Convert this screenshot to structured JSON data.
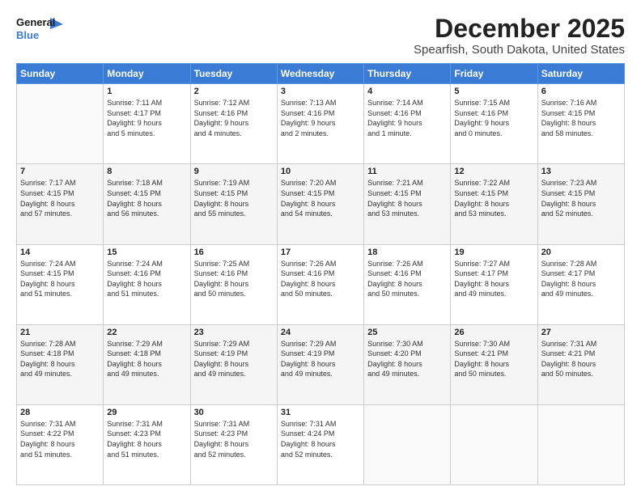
{
  "header": {
    "logo_line1": "General",
    "logo_line2": "Blue",
    "month": "December 2025",
    "location": "Spearfish, South Dakota, United States"
  },
  "weekdays": [
    "Sunday",
    "Monday",
    "Tuesday",
    "Wednesday",
    "Thursday",
    "Friday",
    "Saturday"
  ],
  "weeks": [
    [
      {
        "day": "",
        "info": ""
      },
      {
        "day": "1",
        "info": "Sunrise: 7:11 AM\nSunset: 4:17 PM\nDaylight: 9 hours\nand 5 minutes."
      },
      {
        "day": "2",
        "info": "Sunrise: 7:12 AM\nSunset: 4:16 PM\nDaylight: 9 hours\nand 4 minutes."
      },
      {
        "day": "3",
        "info": "Sunrise: 7:13 AM\nSunset: 4:16 PM\nDaylight: 9 hours\nand 2 minutes."
      },
      {
        "day": "4",
        "info": "Sunrise: 7:14 AM\nSunset: 4:16 PM\nDaylight: 9 hours\nand 1 minute."
      },
      {
        "day": "5",
        "info": "Sunrise: 7:15 AM\nSunset: 4:16 PM\nDaylight: 9 hours\nand 0 minutes."
      },
      {
        "day": "6",
        "info": "Sunrise: 7:16 AM\nSunset: 4:15 PM\nDaylight: 8 hours\nand 58 minutes."
      }
    ],
    [
      {
        "day": "7",
        "info": "Sunrise: 7:17 AM\nSunset: 4:15 PM\nDaylight: 8 hours\nand 57 minutes."
      },
      {
        "day": "8",
        "info": "Sunrise: 7:18 AM\nSunset: 4:15 PM\nDaylight: 8 hours\nand 56 minutes."
      },
      {
        "day": "9",
        "info": "Sunrise: 7:19 AM\nSunset: 4:15 PM\nDaylight: 8 hours\nand 55 minutes."
      },
      {
        "day": "10",
        "info": "Sunrise: 7:20 AM\nSunset: 4:15 PM\nDaylight: 8 hours\nand 54 minutes."
      },
      {
        "day": "11",
        "info": "Sunrise: 7:21 AM\nSunset: 4:15 PM\nDaylight: 8 hours\nand 53 minutes."
      },
      {
        "day": "12",
        "info": "Sunrise: 7:22 AM\nSunset: 4:15 PM\nDaylight: 8 hours\nand 53 minutes."
      },
      {
        "day": "13",
        "info": "Sunrise: 7:23 AM\nSunset: 4:15 PM\nDaylight: 8 hours\nand 52 minutes."
      }
    ],
    [
      {
        "day": "14",
        "info": "Sunrise: 7:24 AM\nSunset: 4:15 PM\nDaylight: 8 hours\nand 51 minutes."
      },
      {
        "day": "15",
        "info": "Sunrise: 7:24 AM\nSunset: 4:16 PM\nDaylight: 8 hours\nand 51 minutes."
      },
      {
        "day": "16",
        "info": "Sunrise: 7:25 AM\nSunset: 4:16 PM\nDaylight: 8 hours\nand 50 minutes."
      },
      {
        "day": "17",
        "info": "Sunrise: 7:26 AM\nSunset: 4:16 PM\nDaylight: 8 hours\nand 50 minutes."
      },
      {
        "day": "18",
        "info": "Sunrise: 7:26 AM\nSunset: 4:16 PM\nDaylight: 8 hours\nand 50 minutes."
      },
      {
        "day": "19",
        "info": "Sunrise: 7:27 AM\nSunset: 4:17 PM\nDaylight: 8 hours\nand 49 minutes."
      },
      {
        "day": "20",
        "info": "Sunrise: 7:28 AM\nSunset: 4:17 PM\nDaylight: 8 hours\nand 49 minutes."
      }
    ],
    [
      {
        "day": "21",
        "info": "Sunrise: 7:28 AM\nSunset: 4:18 PM\nDaylight: 8 hours\nand 49 minutes."
      },
      {
        "day": "22",
        "info": "Sunrise: 7:29 AM\nSunset: 4:18 PM\nDaylight: 8 hours\nand 49 minutes."
      },
      {
        "day": "23",
        "info": "Sunrise: 7:29 AM\nSunset: 4:19 PM\nDaylight: 8 hours\nand 49 minutes."
      },
      {
        "day": "24",
        "info": "Sunrise: 7:29 AM\nSunset: 4:19 PM\nDaylight: 8 hours\nand 49 minutes."
      },
      {
        "day": "25",
        "info": "Sunrise: 7:30 AM\nSunset: 4:20 PM\nDaylight: 8 hours\nand 49 minutes."
      },
      {
        "day": "26",
        "info": "Sunrise: 7:30 AM\nSunset: 4:21 PM\nDaylight: 8 hours\nand 50 minutes."
      },
      {
        "day": "27",
        "info": "Sunrise: 7:31 AM\nSunset: 4:21 PM\nDaylight: 8 hours\nand 50 minutes."
      }
    ],
    [
      {
        "day": "28",
        "info": "Sunrise: 7:31 AM\nSunset: 4:22 PM\nDaylight: 8 hours\nand 51 minutes."
      },
      {
        "day": "29",
        "info": "Sunrise: 7:31 AM\nSunset: 4:23 PM\nDaylight: 8 hours\nand 51 minutes."
      },
      {
        "day": "30",
        "info": "Sunrise: 7:31 AM\nSunset: 4:23 PM\nDaylight: 8 hours\nand 52 minutes."
      },
      {
        "day": "31",
        "info": "Sunrise: 7:31 AM\nSunset: 4:24 PM\nDaylight: 8 hours\nand 52 minutes."
      },
      {
        "day": "",
        "info": ""
      },
      {
        "day": "",
        "info": ""
      },
      {
        "day": "",
        "info": ""
      }
    ]
  ]
}
